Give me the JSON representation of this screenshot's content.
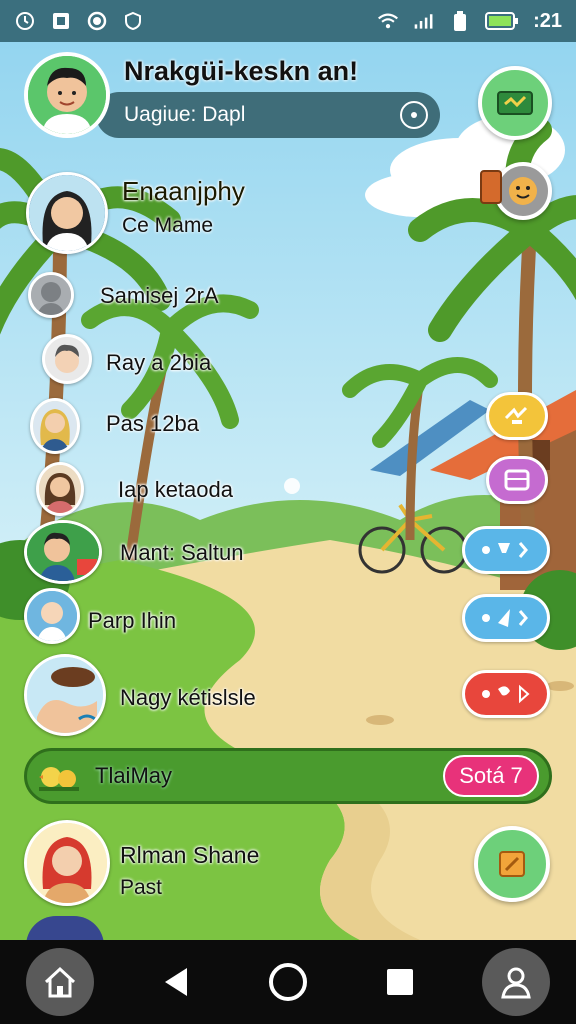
{
  "status_bar": {
    "time": ":21",
    "icons": [
      "clock-icon",
      "square-icon",
      "record-icon",
      "shield-icon",
      "wifi-icon",
      "signal-icon",
      "battery-small-icon",
      "battery-icon"
    ]
  },
  "header": {
    "title": "Nrakgüi-keskn an!",
    "avatar": "profile-avatar"
  },
  "search": {
    "value": "Uagiue: Dapl"
  },
  "chats": [
    {
      "name": "Enaanjphy",
      "subtitle": "Ce Mame"
    },
    {
      "name": "Samisej 2rA",
      "subtitle": ""
    },
    {
      "name": "Ray a 2bia",
      "subtitle": ""
    },
    {
      "name": "Pas 12ba",
      "subtitle": ""
    },
    {
      "name": "Iap ketaoda",
      "subtitle": ""
    },
    {
      "name": "Mant: Saltun",
      "subtitle": ""
    },
    {
      "name": "Parp Ihin",
      "subtitle": ""
    },
    {
      "name": "Nagy kétislsle",
      "subtitle": ""
    }
  ],
  "banner": {
    "label": "TlaiMay",
    "badge": "Sotá 7"
  },
  "last_chat": {
    "name": "Rlman Shane",
    "subtitle": "Past"
  },
  "peek_text": "…… … ……",
  "colors": {
    "status_bar": "#3b6f7e",
    "banner": "#4a9b2e",
    "badge": "#e8327a",
    "pill_blue": "#5ab6e8",
    "pill_red": "#e8463c",
    "pill_yellow": "#f3c43a",
    "pill_purple": "#c56bd0",
    "accent_green": "#5bc66b"
  },
  "bottom_nav": [
    "home-icon",
    "back-icon",
    "home-circle-icon",
    "recents-icon",
    "profile-icon"
  ]
}
